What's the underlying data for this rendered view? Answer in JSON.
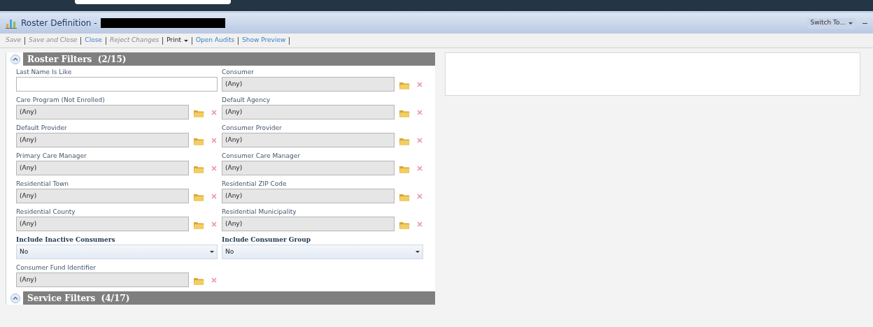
{
  "window": {
    "title": "Roster Definition -",
    "switch_to": "Switch To..."
  },
  "toolbar": [
    {
      "label": "Save",
      "kind": "action",
      "disabled": true
    },
    {
      "label": "Save and Close",
      "kind": "action",
      "disabled": true
    },
    {
      "label": "Close",
      "kind": "action",
      "disabled": false
    },
    {
      "label": "Reject Changes",
      "kind": "action",
      "disabled": true
    },
    {
      "label": "Print",
      "kind": "menu",
      "disabled": false
    },
    {
      "label": "Open Audits",
      "kind": "action",
      "disabled": false
    },
    {
      "label": "Show Preview",
      "kind": "action",
      "disabled": false
    }
  ],
  "sections": [
    {
      "title": "Roster Filters  (2/15)",
      "expanded": true,
      "fields": [
        {
          "label": "Last Name Is Like",
          "kind": "text"
        },
        {
          "label": "Consumer",
          "kind": "lookup",
          "value": "(Any)"
        },
        {
          "label": "Care Program (Not Enrolled)",
          "kind": "lookup",
          "value": "(Any)"
        },
        {
          "label": "Default Agency",
          "kind": "lookup",
          "value": "(Any)"
        },
        {
          "label": "Default Provider",
          "kind": "lookup",
          "value": "(Any)"
        },
        {
          "label": "Consumer Provider",
          "kind": "lookup",
          "value": "(Any)"
        },
        {
          "label": "Primary Care Manager",
          "kind": "lookup",
          "value": "(Any)"
        },
        {
          "label": "Consumer Care Manager",
          "kind": "lookup",
          "value": "(Any)"
        },
        {
          "label": "Residential Town",
          "kind": "lookup",
          "value": "(Any)"
        },
        {
          "label": "Residential ZIP Code",
          "kind": "lookup",
          "value": "(Any)"
        },
        {
          "label": "Residential County",
          "kind": "lookup",
          "value": "(Any)"
        },
        {
          "label": "Residential Municipality",
          "kind": "lookup",
          "value": "(Any)"
        },
        {
          "label": "Include Inactive Consumers",
          "kind": "select",
          "value": "No"
        },
        {
          "label": "Include Consumer Group",
          "kind": "select",
          "value": "No"
        },
        {
          "label": "Consumer Fund Identifier",
          "kind": "lookup",
          "value": "(Any)"
        }
      ]
    },
    {
      "title": "Service Filters  (4/17)",
      "expanded": true
    }
  ]
}
